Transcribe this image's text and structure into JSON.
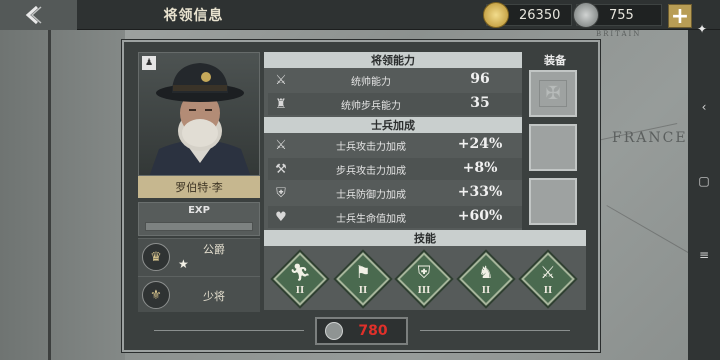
{
  "header": {
    "title": "将领信息",
    "gold": "26350",
    "medals": "755"
  },
  "map": {
    "label_france": "FRANCE",
    "label_top": "BRITAIN"
  },
  "general": {
    "name": "罗伯特·李",
    "exp_label": "EXP",
    "exp_progress": 0,
    "title_rank": "公爵",
    "title_stars": "★",
    "military_rank": "少将"
  },
  "abilities": {
    "header": "将领能力",
    "rows": [
      {
        "label": "统帅能力",
        "value": "96"
      },
      {
        "label": "统帅步兵能力",
        "value": "35"
      }
    ]
  },
  "bonuses": {
    "header": "士兵加成",
    "rows": [
      {
        "label": "士兵攻击力加成",
        "value": "+24%"
      },
      {
        "label": "步兵攻击力加成",
        "value": "+8%"
      },
      {
        "label": "士兵防御力加成",
        "value": "+33%"
      },
      {
        "label": "士兵生命值加成",
        "value": "+60%"
      }
    ]
  },
  "equipment": {
    "header": "装备"
  },
  "skills": {
    "header": "技能",
    "items": [
      {
        "level": "II"
      },
      {
        "level": "II"
      },
      {
        "level": "III"
      },
      {
        "level": "II"
      },
      {
        "level": "II"
      }
    ]
  },
  "footer": {
    "cost": "780"
  }
}
